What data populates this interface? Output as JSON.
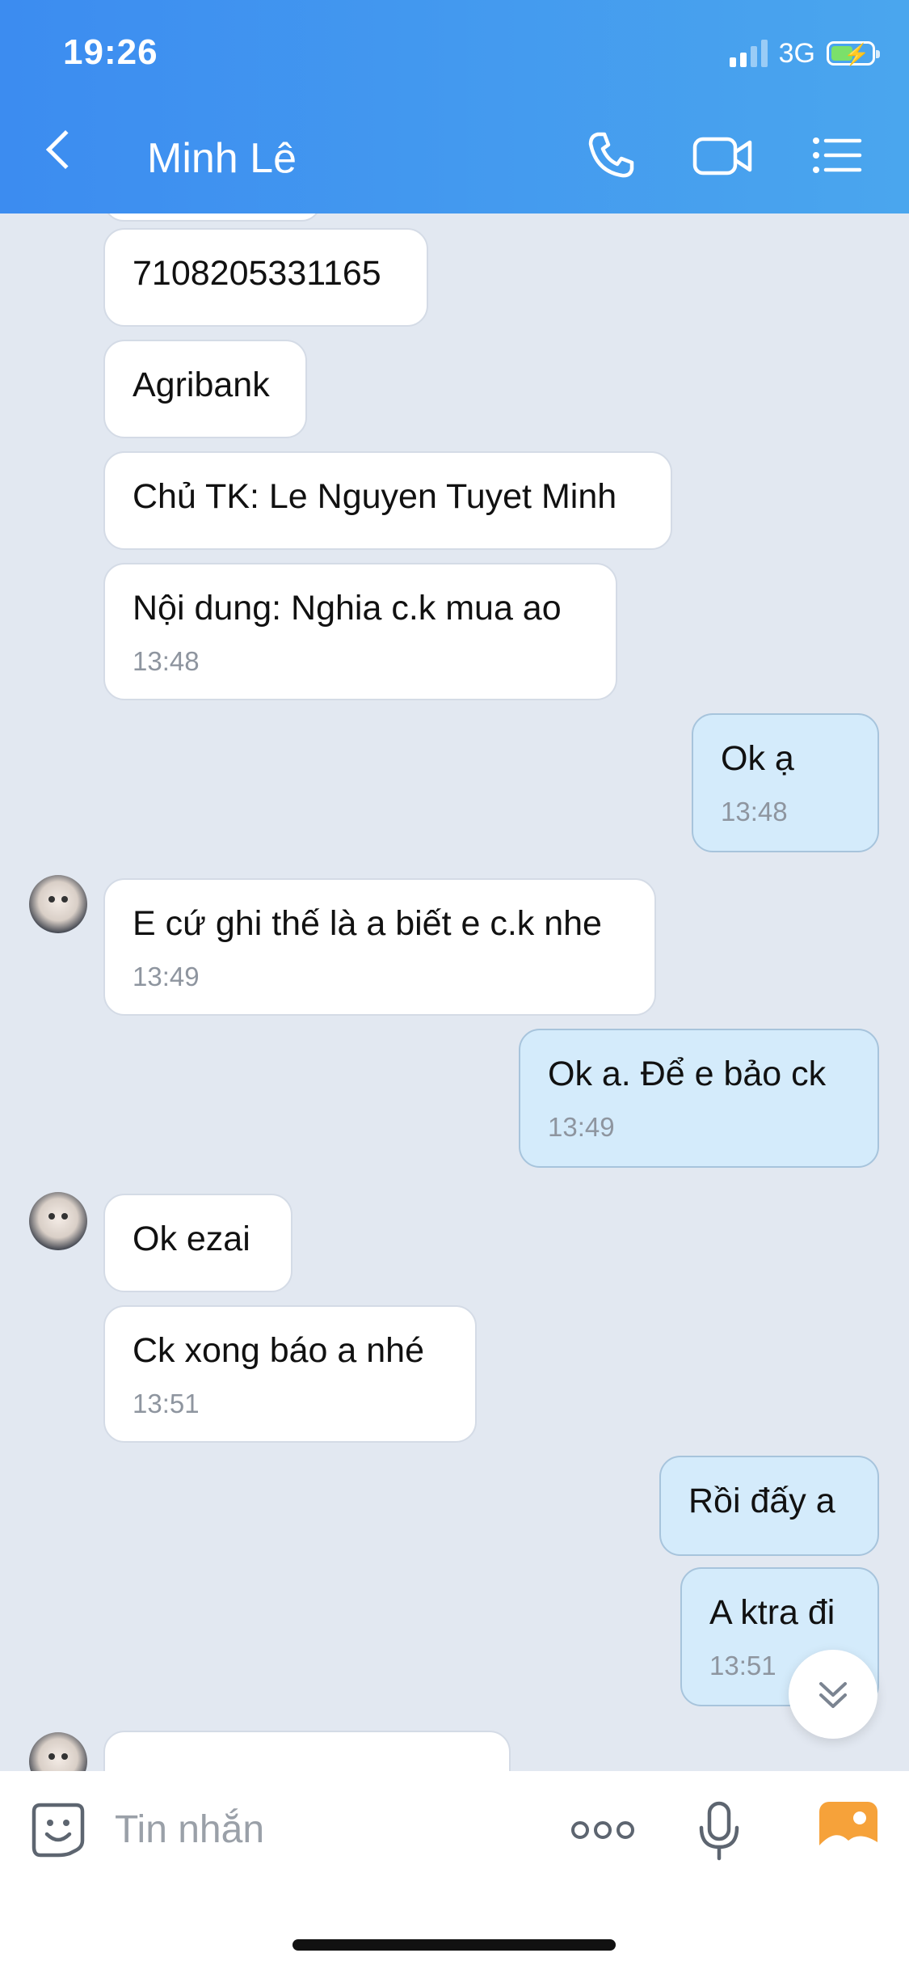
{
  "status_bar": {
    "time": "19:26",
    "network": "3G"
  },
  "header": {
    "contact_name": "Minh Lê",
    "icons": [
      "back-chevron-icon",
      "phone-icon",
      "video-call-icon",
      "menu-list-icon"
    ]
  },
  "messages": [
    {
      "side": "received",
      "text": "7108205331165",
      "time": ""
    },
    {
      "side": "received",
      "text": "Agribank",
      "time": ""
    },
    {
      "side": "received",
      "text": "Chủ TK: Le Nguyen Tuyet Minh",
      "time": ""
    },
    {
      "side": "received",
      "text": "Nội dung: Nghia c.k mua ao",
      "time": "13:48"
    },
    {
      "side": "sent",
      "text": "Ok ạ",
      "time": "13:48"
    },
    {
      "side": "received",
      "text": "E cứ ghi thế là a biết e c.k nhe",
      "time": "13:49"
    },
    {
      "side": "sent",
      "text": "Ok a. Để e bảo ck",
      "time": "13:49"
    },
    {
      "side": "received",
      "text": "Ok ezai",
      "time": ""
    },
    {
      "side": "received",
      "text": "Ck xong báo a nhé",
      "time": "13:51"
    },
    {
      "side": "sent",
      "text": "Rồi đấy a",
      "time": ""
    },
    {
      "side": "sent",
      "text": "A ktra đi",
      "time": "13:51"
    }
  ],
  "composer": {
    "placeholder": "Tin nhắn",
    "icons": [
      "sticker-icon",
      "more-options-icon",
      "microphone-icon",
      "photo-gallery-icon"
    ]
  },
  "colors": {
    "header_start": "#3c8cf0",
    "header_end": "#4aa6ee",
    "chat_background": "#e2e8f1",
    "sent_bubble": "#d4ebfb",
    "received_bubble": "#ffffff"
  }
}
